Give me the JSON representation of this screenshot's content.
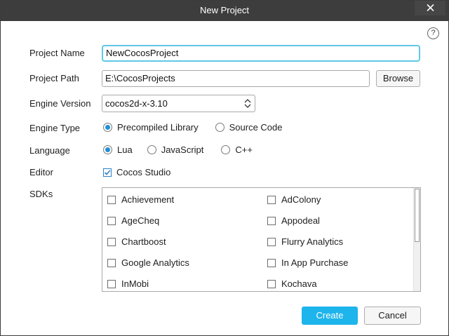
{
  "window": {
    "title": "New Project"
  },
  "help": {
    "glyph": "?"
  },
  "form": {
    "project_name": {
      "label": "Project Name",
      "value": "NewCocosProject"
    },
    "project_path": {
      "label": "Project Path",
      "value": "E:\\CocosProjects",
      "browse_label": "Browse"
    },
    "engine_version": {
      "label": "Engine Version",
      "value": "cocos2d-x-3.10"
    },
    "engine_type": {
      "label": "Engine Type",
      "options": [
        "Precompiled Library",
        "Source Code"
      ],
      "selected": "Precompiled Library"
    },
    "language": {
      "label": "Language",
      "options": [
        "Lua",
        "JavaScript",
        "C++"
      ],
      "selected": "Lua"
    },
    "editor": {
      "label": "Editor",
      "option": "Cocos Studio",
      "checked": true
    },
    "sdks": {
      "label": "SDKs",
      "items": [
        {
          "name": "Achievement",
          "checked": false
        },
        {
          "name": "AdColony",
          "checked": false
        },
        {
          "name": "AgeCheq",
          "checked": false
        },
        {
          "name": "Appodeal",
          "checked": false
        },
        {
          "name": "Chartboost",
          "checked": false
        },
        {
          "name": "Flurry Analytics",
          "checked": false
        },
        {
          "name": "Google Analytics",
          "checked": false
        },
        {
          "name": "In App Purchase",
          "checked": false
        },
        {
          "name": "InMobi",
          "checked": false
        },
        {
          "name": "Kochava",
          "checked": false
        }
      ]
    }
  },
  "footer": {
    "create_label": "Create",
    "cancel_label": "Cancel"
  },
  "colors": {
    "accent": "#1eb4ec",
    "focus": "#5fc8e4",
    "titlebar": "#3d3d3d"
  }
}
